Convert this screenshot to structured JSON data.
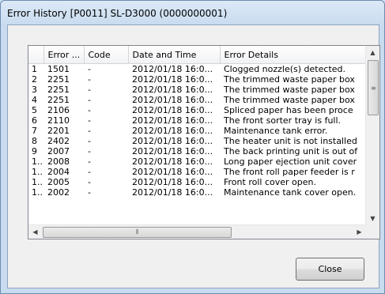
{
  "window": {
    "title": "Error History  [P0011]  SL-D3000  (0000000001)"
  },
  "table": {
    "columns": [
      "",
      "Error ...",
      "Code",
      "Date and Time",
      "Error Details"
    ],
    "rows": [
      [
        "1",
        "1501",
        "-",
        "2012/01/18 16:0...",
        "Clogged nozzle(s) detected."
      ],
      [
        "2",
        "2251",
        "-",
        "2012/01/18 16:0...",
        "The trimmed waste paper box"
      ],
      [
        "3",
        "2251",
        "-",
        "2012/01/18 16:0...",
        "The trimmed waste paper box"
      ],
      [
        "4",
        "2251",
        "-",
        "2012/01/18 16:0...",
        "The trimmed waste paper box"
      ],
      [
        "5",
        "2106",
        "-",
        "2012/01/18 16:0...",
        "Spliced paper has been proce"
      ],
      [
        "6",
        "2110",
        "-",
        "2012/01/18 16:0...",
        "The front sorter tray is full."
      ],
      [
        "7",
        "2201",
        "-",
        "2012/01/18 16:0...",
        "Maintenance tank error."
      ],
      [
        "8",
        "2402",
        "-",
        "2012/01/18 16:0...",
        "The heater unit is not installed"
      ],
      [
        "9",
        "2007",
        "-",
        "2012/01/18 16:0...",
        "The back printing unit is out of"
      ],
      [
        "1..",
        "2008",
        "-",
        "2012/01/18 16:0...",
        "Long paper ejection unit cover"
      ],
      [
        "1..",
        "2004",
        "-",
        "2012/01/18 16:0...",
        "The front roll paper feeder is r"
      ],
      [
        "1..",
        "2005",
        "-",
        "2012/01/18 16:0...",
        "Front roll cover open."
      ],
      [
        "1..",
        "2002",
        "-",
        "2012/01/18 16:0...",
        "Maintenance tank cover open."
      ]
    ]
  },
  "scrollbar": {
    "up_icon": "arrow-up",
    "down_icon": "arrow-down",
    "left_icon": "arrow-left",
    "right_icon": "arrow-right",
    "grip": "grip-icon"
  },
  "buttons": {
    "close_label": "Close"
  }
}
